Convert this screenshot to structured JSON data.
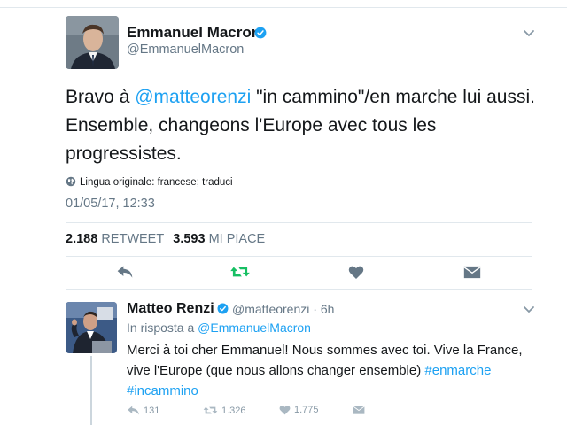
{
  "main_tweet": {
    "author_name": "Emmanuel Macron",
    "author_handle": "@EmmanuelMacron",
    "text_prefix": "Bravo à ",
    "mention": "@matteorenzi",
    "text_suffix": " \"in cammino\"/en marche lui aussi. Ensemble, changeons l'Europe avec tous les progressistes.",
    "language_note": "Lingua originale: francese; traduci",
    "timestamp": "01/05/17, 12:33",
    "retweet_count": "2.188",
    "retweet_label": "RETWEET",
    "like_count": "3.593",
    "like_label": "MI PIACE"
  },
  "reply_tweet": {
    "author_name": "Matteo Renzi",
    "author_handle": "@matteorenzi",
    "separator": " · ",
    "time": "6h",
    "in_reply_prefix": "In risposta a ",
    "in_reply_handle": "@EmmanuelMacron",
    "text": "Merci à toi cher Emmanuel! Nous sommes avec toi. Vive la France, vive l'Europe (que nous allons changer ensemble) ",
    "hashtag1": "#enmarche",
    "hashtag2": "#incammino",
    "reply_count": "131",
    "retweet_count": "1.326",
    "like_count": "1.775"
  },
  "icons": [
    "verified-icon",
    "chevron-down-icon",
    "globe-icon",
    "reply-icon",
    "retweet-icon",
    "heart-icon",
    "message-icon"
  ],
  "colors": {
    "link": "#1da1f2",
    "verified": "#1da1f2",
    "retweet_active": "#17bf63",
    "muted": "#657786",
    "text": "#14171a"
  }
}
